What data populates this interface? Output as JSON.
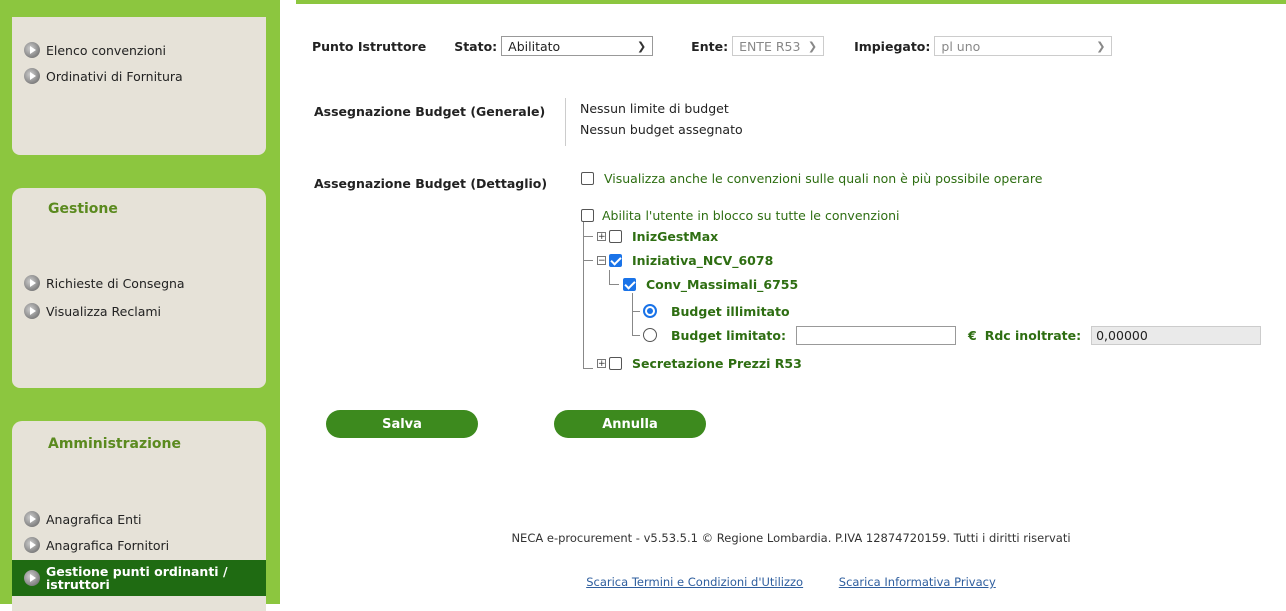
{
  "sidebar": {
    "panel1": {
      "items": [
        {
          "label": "Elenco convenzioni"
        },
        {
          "label": "Ordinativi di Fornitura"
        }
      ]
    },
    "panel2": {
      "title": "Gestione",
      "items": [
        {
          "label": "Richieste di Consegna"
        },
        {
          "label": "Visualizza Reclami"
        }
      ]
    },
    "panel3": {
      "title": "Amministrazione",
      "items": [
        {
          "label": "Anagrafica Enti"
        },
        {
          "label": "Anagrafica Fornitori"
        },
        {
          "label": "Gestione punti ordinanti / istruttori"
        }
      ]
    }
  },
  "filters": {
    "title": "Punto Istruttore",
    "stato_label": "Stato:",
    "stato_value": "Abilitato",
    "ente_label": "Ente:",
    "ente_value": "ENTE R53",
    "impiegato_label": "Impiegato:",
    "impiegato_value": "pl uno"
  },
  "budget_generale": {
    "label": "Assegnazione Budget (Generale)",
    "line1": "Nessun limite di budget",
    "line2": "Nessun budget assegnato"
  },
  "budget_dettaglio": {
    "label": "Assegnazione Budget (Dettaglio)",
    "show_all_label": "Visualizza anche le convenzioni sulle quali non è più possibile operare",
    "enable_all_label": "Abilita l'utente in blocco su tutte le convenzioni",
    "tree": {
      "node1": "InizGestMax",
      "node2": "Iniziativa_NCV_6078",
      "node2_child": "Conv_Massimali_6755",
      "radio_unlimited": "Budget illimitato",
      "radio_limited": "Budget limitato:",
      "limited_value": "",
      "currency": "€",
      "rdc_label": "Rdc inoltrate:",
      "rdc_value": "0,00000",
      "node3": "Secretazione Prezzi R53"
    }
  },
  "buttons": {
    "save": "Salva",
    "cancel": "Annulla"
  },
  "footer": {
    "text": "NECA e-procurement - v5.53.5.1 © Regione Lombardia. P.IVA 12874720159. Tutti i diritti riservati",
    "link1": "Scarica Termini e Condizioni d'Utilizzo",
    "link2": "Scarica Informativa Privacy"
  },
  "colors": {
    "brand_green": "#8cc63f",
    "dark_green": "#1f6b12",
    "button_green": "#3d8a1e",
    "panel_bg": "#e6e2d8",
    "checkbox_blue": "#1a73e8"
  }
}
